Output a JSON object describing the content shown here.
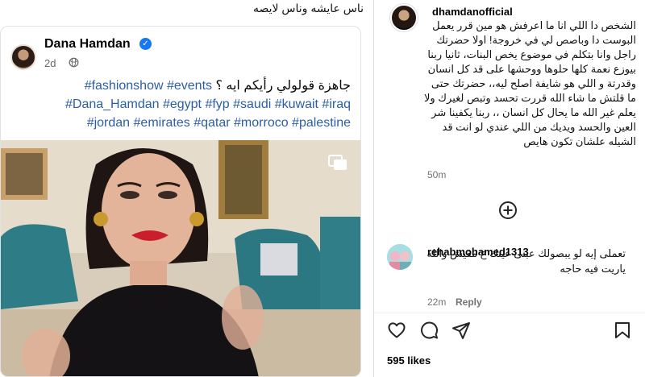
{
  "media": {
    "caption": "ناس عايشه وناس لايصه",
    "post": {
      "author": "Dana Hamdan",
      "time": "2d",
      "text_line1_arabic": "جاهزة قولولي رأيكم ايه ؟ ",
      "text_line1_tags": "#fashionshow #events",
      "text_line2": "#Dana_Hamdan #egypt #fyp #saudi #kuwait #iraq",
      "text_line3": "#jordan #emirates #qatar #morroco #palestine"
    }
  },
  "caption": {
    "username": "dhamdanofficial",
    "text": "الشخص دا اللي انا ما اعرفش هو مين قرر يعمل البوست دا وباصص لي في خروجة! اولا حضرتك راجل وانا بتكلم في موضوع يخص البنات، ثانيا ربنا بيوزع نعمة كلها حلوها ووحشها على قد كل انسان وقدرتة و اللي هو شايفة اصلح ليه،، حضرتك حتى ما قلتش ما شاء الله قررت تحسد وتبص لغيرك ولا يعلم غير الله ما يحال كل انسان ،، ربنا يكفينا شر العين والحسد ويديك من اللي عندي لو انت قد الشيله علشان تكون هايص",
    "time": "50m"
  },
  "comment": {
    "username": "rehabmohamed1313",
    "text": "تعملى إيه لو يبصولك عبنى عينك ع مفيش والله ياريت فيه حاجه",
    "time": "22m",
    "reply_label": "Reply"
  },
  "actions": {
    "likes": "595 likes"
  },
  "icons": {
    "load_more": "plus-circle-icon",
    "like": "heart-icon",
    "comment": "comment-icon",
    "share": "send-icon",
    "save": "bookmark-icon"
  }
}
